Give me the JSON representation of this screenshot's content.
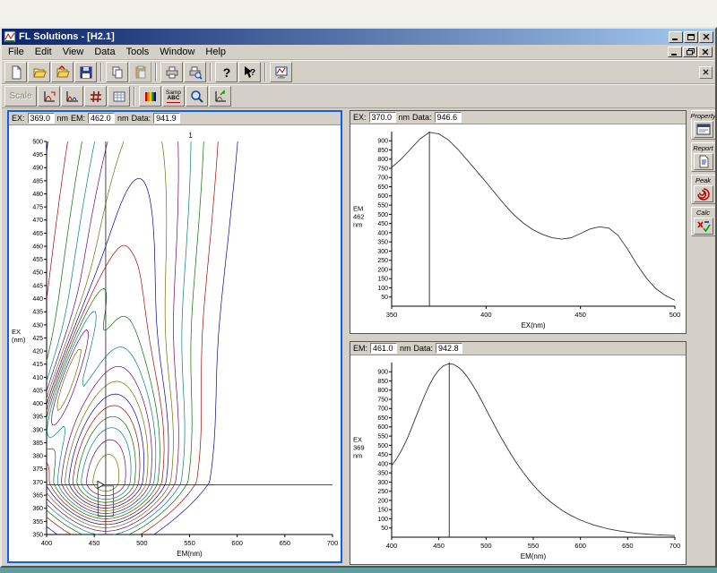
{
  "window": {
    "title": "FL Solutions - [H2.1]"
  },
  "menu": {
    "items": [
      "File",
      "Edit",
      "View",
      "Data",
      "Tools",
      "Window",
      "Help"
    ]
  },
  "toolbar": {
    "icons": [
      "new-file",
      "open-folder",
      "open-data",
      "save",
      "copy",
      "paste",
      "print",
      "print-preview",
      "help",
      "context-help",
      "monitor-chart"
    ]
  },
  "toolbar2": {
    "scale_label": "Scale",
    "samp_line1": "Samp",
    "samp_line2": "ABC"
  },
  "side_toolbar": {
    "buttons": [
      {
        "label": "Property"
      },
      {
        "label": "Report"
      },
      {
        "label": "Peak"
      },
      {
        "label": "Calc"
      }
    ]
  },
  "panels": {
    "contour": {
      "header": {
        "f1_label": "EX:",
        "f1_value": "369.0",
        "f1_unit": "nm",
        "f2_label": "EM:",
        "f2_value": "462.0",
        "f2_unit": "nm",
        "f3_label": "Data:",
        "f3_value": "941.9"
      }
    },
    "ex_scan": {
      "header": {
        "f1_label": "EX:",
        "f1_value": "370.0",
        "f1_unit": "nm",
        "f3_label": "Data:",
        "f3_value": "946.6"
      }
    },
    "em_scan": {
      "header": {
        "f1_label": "EM:",
        "f1_value": "461.0",
        "f1_unit": "nm",
        "f3_label": "Data:",
        "f3_value": "942.8"
      }
    }
  },
  "chart_data": [
    {
      "id": "contour-chart",
      "type": "contour",
      "x_label": "EM(nm)",
      "side_label": [
        "EX",
        "(nm)"
      ],
      "x_range": [
        400,
        700
      ],
      "y_range": [
        350,
        500
      ],
      "x_ticks": [
        400,
        450,
        500,
        550,
        600,
        650,
        700
      ],
      "y_tick_start": 350,
      "y_tick_max": 500,
      "y_tick_step": 5,
      "level_step": 50,
      "level_max": 900,
      "peak": {
        "em": 462,
        "ex": 370,
        "value": 941.9
      },
      "crosshair": {
        "em": 462,
        "ex": 369
      },
      "selection_box": {
        "em0": 454,
        "em1": 470,
        "ex0": 357,
        "ex1": 368.5
      },
      "peak_marker": {
        "label": "1",
        "em": 551
      },
      "palette": [
        "#0000b0",
        "#b00000",
        "#007000",
        "#008080",
        "#700070",
        "#6f6f00"
      ],
      "model": {
        "amp": 941.9,
        "em0": 462,
        "ex0": 370,
        "sig_em_base": 45,
        "sig_em_down_slope": 0.75,
        "sig_em_up_slope": 0.05,
        "em_shift_up": 0.3,
        "up_mix": [
          [
            0.5,
            25
          ],
          [
            0.5,
            150
          ]
        ],
        "sig_ex_down": 11.5,
        "ridge_amp": 320,
        "ridge_offset": 12,
        "ridge_sig": 9,
        "ridge_ex_center": 408,
        "ridge_ex_sig": 22
      }
    },
    {
      "id": "ex-scan-chart",
      "type": "line",
      "x_label": "EX(nm)",
      "side_label": [
        "EM",
        "462",
        "nm"
      ],
      "x_range": [
        350,
        500
      ],
      "y_range": [
        0,
        950
      ],
      "x_ticks": [
        350,
        400,
        450,
        500
      ],
      "y_tick_start": 50,
      "y_tick_max": 900,
      "y_tick_step": 50,
      "cursor_x": 370,
      "x": [
        350,
        355,
        360,
        365,
        370,
        375,
        380,
        385,
        390,
        395,
        400,
        405,
        410,
        415,
        420,
        425,
        430,
        435,
        440,
        445,
        450,
        455,
        460,
        465,
        470,
        475,
        480,
        485,
        490,
        495,
        500
      ],
      "y": [
        755,
        800,
        855,
        910,
        946.6,
        938,
        905,
        855,
        795,
        735,
        675,
        612,
        550,
        495,
        450,
        415,
        390,
        372,
        365,
        372,
        395,
        420,
        432,
        425,
        385,
        310,
        225,
        152,
        95,
        58,
        32
      ]
    },
    {
      "id": "em-scan-chart",
      "type": "line",
      "x_label": "EM(nm)",
      "side_label": [
        "EX",
        "369",
        "nm"
      ],
      "x_range": [
        400,
        700
      ],
      "y_range": [
        0,
        950
      ],
      "x_ticks": [
        400,
        450,
        500,
        550,
        600,
        650,
        700
      ],
      "y_tick_start": 50,
      "y_tick_max": 900,
      "y_tick_step": 50,
      "cursor_x": 461,
      "x": [
        400,
        405,
        410,
        415,
        420,
        425,
        430,
        435,
        440,
        445,
        450,
        455,
        460,
        465,
        470,
        475,
        480,
        485,
        490,
        495,
        500,
        505,
        510,
        515,
        520,
        525,
        530,
        535,
        540,
        545,
        550,
        555,
        560,
        565,
        570,
        575,
        580,
        585,
        590,
        595,
        600,
        605,
        610,
        615,
        620,
        625,
        630,
        635,
        640,
        645,
        650,
        655,
        660,
        665,
        670,
        675,
        680,
        685,
        690,
        695,
        700
      ],
      "y": [
        390,
        425,
        468,
        520,
        580,
        645,
        710,
        772,
        828,
        875,
        910,
        933,
        942.8,
        941,
        928,
        905,
        873,
        835,
        792,
        745,
        696,
        647,
        598,
        551,
        506,
        463,
        422,
        384,
        348,
        315,
        284,
        256,
        230,
        207,
        185,
        166,
        148,
        132,
        118,
        105,
        93,
        83,
        74,
        65,
        58,
        51,
        45,
        40,
        35,
        31,
        27,
        24,
        21,
        19,
        17,
        15,
        13,
        12,
        11,
        10,
        9
      ]
    }
  ]
}
